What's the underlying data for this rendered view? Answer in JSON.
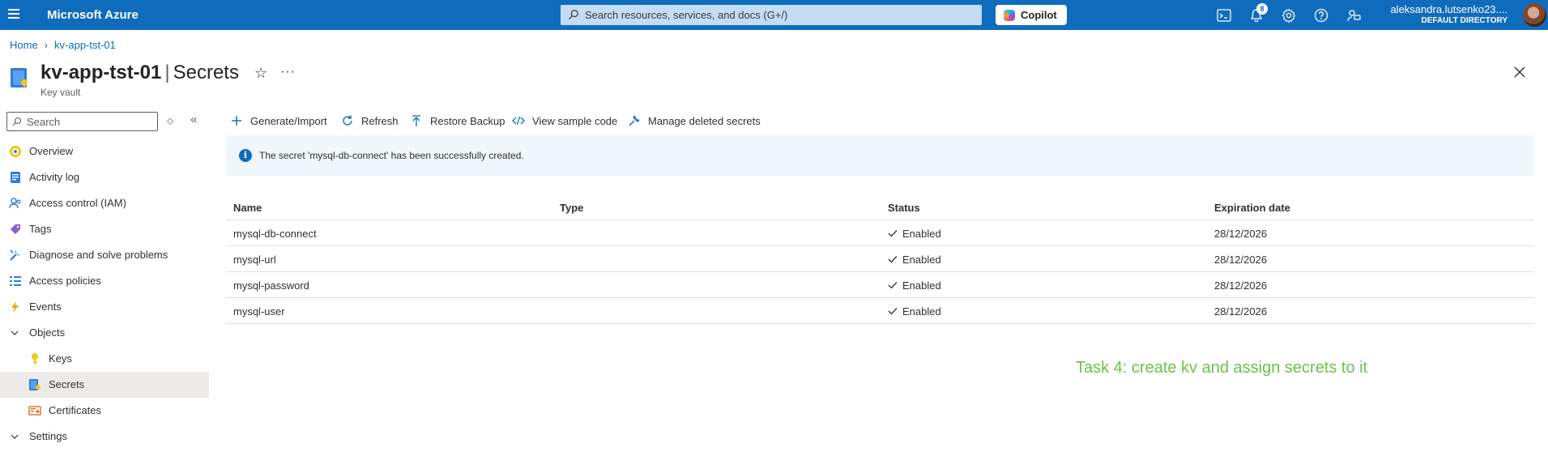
{
  "topbar": {
    "brand": "Microsoft Azure",
    "search_placeholder": "Search resources, services, and docs (G+/)",
    "copilot_label": "Copilot",
    "notification_count": "8",
    "user_name": "aleksandra.lutsenko23....",
    "user_directory": "DEFAULT DIRECTORY",
    "accent": "#0f6cbd"
  },
  "breadcrumb": {
    "home": "Home",
    "current": "kv-app-tst-01"
  },
  "header": {
    "resource_name": "kv-app-tst-01",
    "separator": "|",
    "section": "Secrets",
    "subtitle": "Key vault"
  },
  "sidebar": {
    "search_placeholder": "Search",
    "items": [
      {
        "label": "Overview",
        "icon": "overview-icon"
      },
      {
        "label": "Activity log",
        "icon": "activity-log-icon"
      },
      {
        "label": "Access control (IAM)",
        "icon": "iam-icon"
      },
      {
        "label": "Tags",
        "icon": "tag-icon"
      },
      {
        "label": "Diagnose and solve problems",
        "icon": "diagnose-icon"
      },
      {
        "label": "Access policies",
        "icon": "access-policies-icon"
      },
      {
        "label": "Events",
        "icon": "lightning-icon"
      },
      {
        "label": "Objects",
        "icon": "chevron-down-icon"
      },
      {
        "label": "Keys",
        "icon": "key-icon"
      },
      {
        "label": "Secrets",
        "icon": "secret-icon",
        "active": true
      },
      {
        "label": "Certificates",
        "icon": "certificate-icon"
      },
      {
        "label": "Settings",
        "icon": "chevron-down-icon"
      }
    ]
  },
  "toolbar": {
    "generate": "Generate/Import",
    "refresh": "Refresh",
    "restore": "Restore Backup",
    "sample": "View sample code",
    "deleted": "Manage deleted secrets"
  },
  "banner": {
    "message": "The secret 'mysql-db-connect' has been successfully created."
  },
  "table": {
    "columns": [
      "Name",
      "Type",
      "Status",
      "Expiration date"
    ],
    "rows": [
      {
        "name": "mysql-db-connect",
        "type": "",
        "status": "Enabled",
        "expiration": "28/12/2026"
      },
      {
        "name": "mysql-url",
        "type": "",
        "status": "Enabled",
        "expiration": "28/12/2026"
      },
      {
        "name": "mysql-password",
        "type": "",
        "status": "Enabled",
        "expiration": "28/12/2026"
      },
      {
        "name": "mysql-user",
        "type": "",
        "status": "Enabled",
        "expiration": "28/12/2026"
      }
    ]
  },
  "note": {
    "text": "Task 4: create kv and assign secrets to it",
    "color": "#6cc24a"
  }
}
